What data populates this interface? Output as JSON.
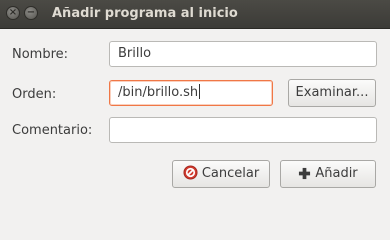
{
  "window": {
    "title": "Añadir programa al inicio",
    "close_glyph": "×",
    "minimize_glyph": "−"
  },
  "form": {
    "name_label": "Nombre:",
    "name_value": "Brillo",
    "command_label": "Orden:",
    "command_value": "/bin/brillo.sh",
    "comment_label": "Comentario:",
    "comment_value": ""
  },
  "buttons": {
    "browse_label": "Examinar...",
    "cancel_label": "Cancelar",
    "add_label": "Añadir"
  },
  "icons": {
    "cancel": "cancel-icon",
    "add": "plus-icon"
  },
  "colors": {
    "focus_border": "#f07746",
    "cancel_icon": "#d13a2e",
    "titlebar": "#3c3b37"
  }
}
